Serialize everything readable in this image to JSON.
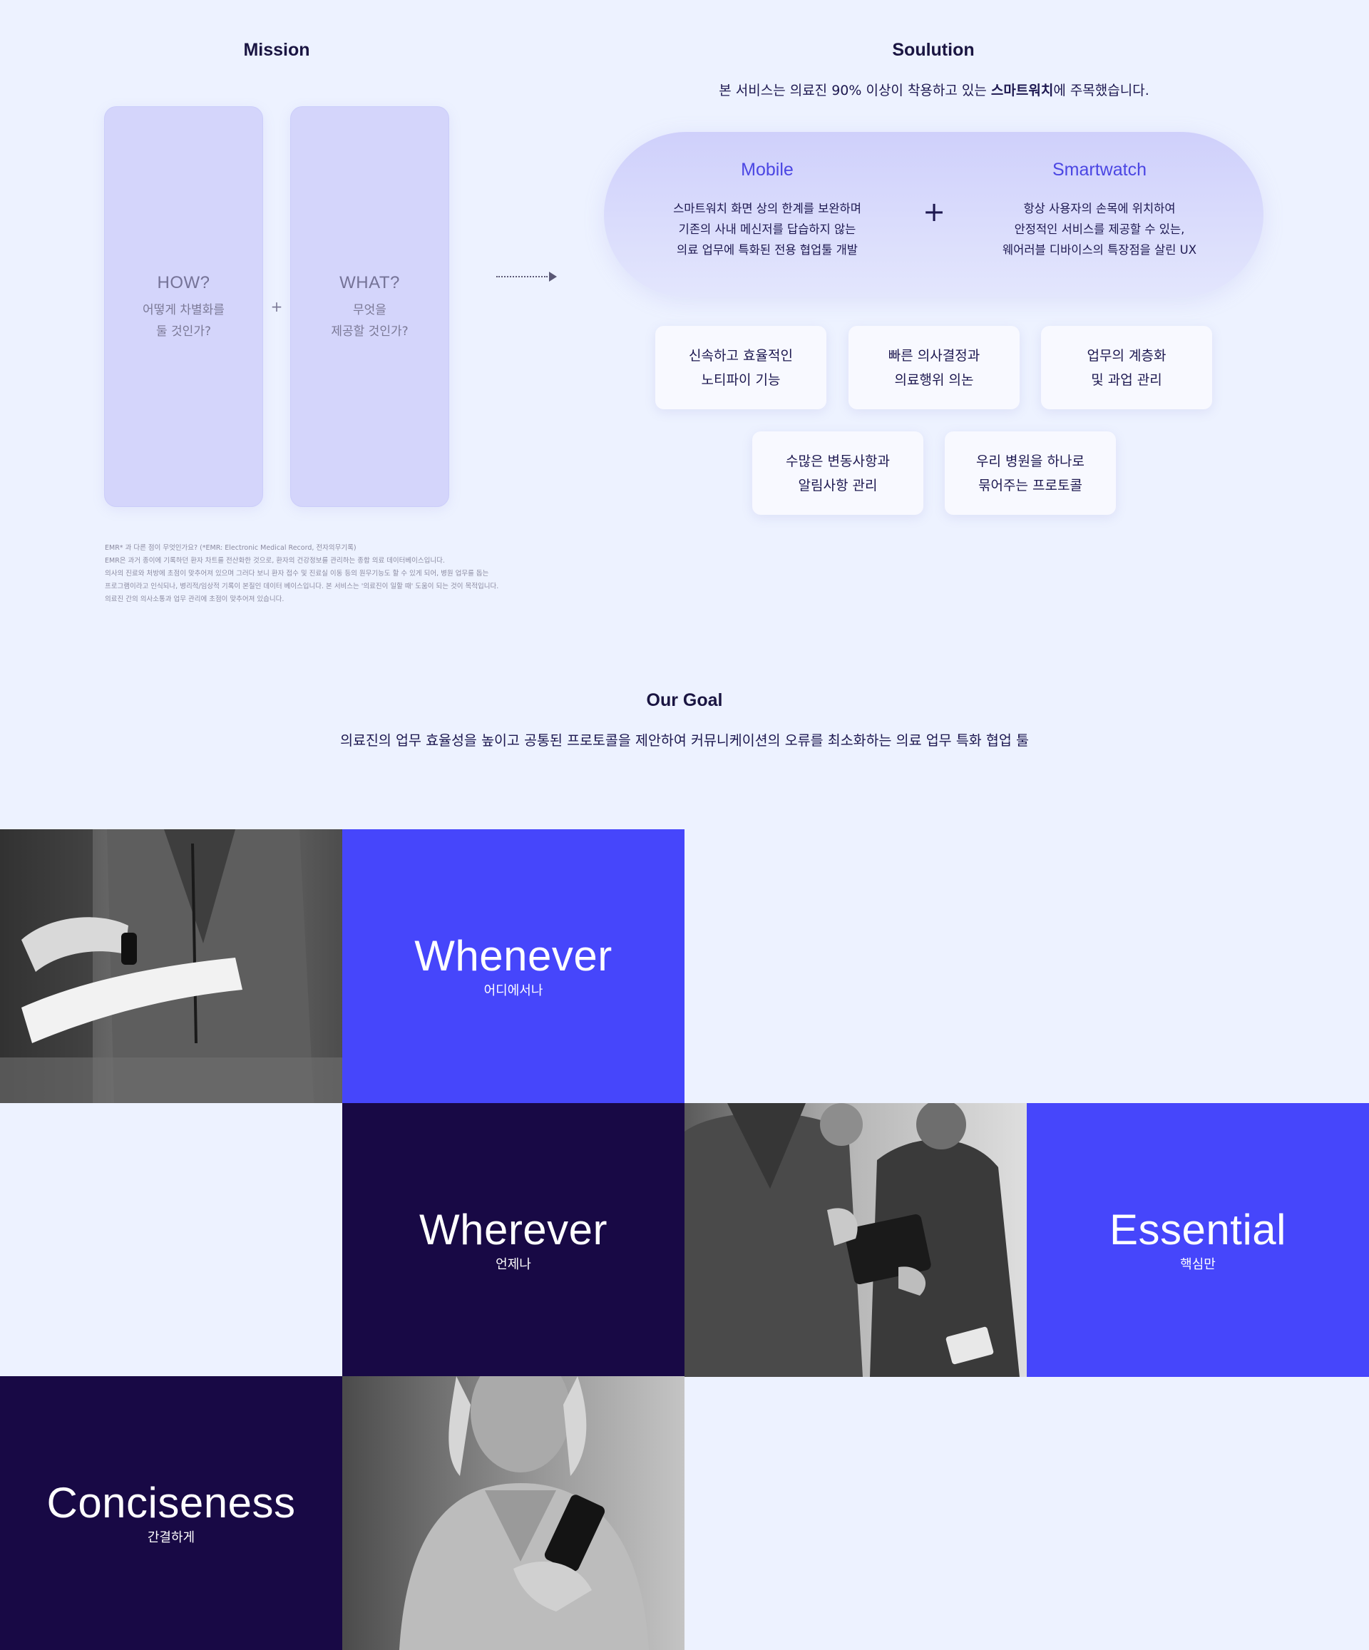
{
  "mission": {
    "title": "Mission",
    "how": {
      "q": "HOW?",
      "line1": "어떻게 차별화를",
      "line2": "둘 것인가?"
    },
    "plus": "+",
    "what": {
      "q": "WHAT?",
      "line1": "무엇을",
      "line2": "제공할 것인가?"
    },
    "emr_notes": [
      "EMR* 과 다른 점이 무엇인가요? (*EMR:  Electronic Medical Record, 전자의무기록)",
      "EMR은 과거 종이에 기록하던 환자 차트를 전산화한 것으로, 환자의 건강정보를 관리하는 종합 의료 데이터베이스입니다.",
      "의사의 진료와 처방에 초점이 맞추어져 있으며 그러다 보니 환자 접수 및 진료실 이동 등의 원무기능도 할 수 있게 되어, 병원 업무를 돕는",
      "프로그램이라고 인식되나, 병리적/임상적 기록이 본질인 데이터 베이스입니다. 본 서비스는 '의료진이 일할 때' 도움이 되는 것이 목적입니다.",
      "의료진 간의 의사소통과 업무 관리에 초점이 맞추어져 있습니다."
    ]
  },
  "solution": {
    "title": "Soulution",
    "intro_pre": "본 서비스는 의료진 90% 이상이 착용하고 있는 ",
    "intro_bold": "스마트워치",
    "intro_post": "에 주목했습니다.",
    "mobile": {
      "title": "Mobile",
      "lines": [
        "스마트워치 화면 상의 한계를  보완하며",
        "기존의 사내 메신저를 답습하지 않는",
        "의료 업무에 특화된 전용 협업툴 개발"
      ]
    },
    "plus": "+",
    "smartwatch": {
      "title": "Smartwatch",
      "lines": [
        "항상 사용자의 손목에 위치하여",
        "안정적인 서비스를 제공할 수 있는,",
        "웨어러블 디바이스의 특장점을 살린 UX"
      ]
    },
    "features": [
      {
        "line1": "신속하고 효율적인",
        "line2": "노티파이 기능"
      },
      {
        "line1": "빠른 의사결정과",
        "line2": "의료행위 의논"
      },
      {
        "line1": "업무의 계층화",
        "line2": "및 과업 관리"
      },
      {
        "line1": "수많은 변동사항과",
        "line2": "알림사항 관리"
      },
      {
        "line1": "우리 병원을 하나로",
        "line2": "묶어주는 프로토콜"
      }
    ]
  },
  "goal": {
    "title": "Our Goal",
    "text": "의료진의 업무 효율성을 높이고 공통된 프로토콜을 제안하여 커뮤니케이션의 오류를 최소화하는 의료 업무 특화 협업 툴"
  },
  "tiles": {
    "whenever": {
      "en": "Whenever",
      "ko": "어디에서나"
    },
    "wherever": {
      "en": "Wherever",
      "ko": "언제나"
    },
    "essential": {
      "en": "Essential",
      "ko": "핵심만"
    },
    "conciseness": {
      "en": "Conciseness",
      "ko": "간결하게"
    }
  },
  "colors": {
    "background": "#edf2ff",
    "accent_blue": "#4646fb",
    "navy": "#180945",
    "mission_card": "#d4d5fb",
    "title_blue": "#4b46e3"
  }
}
